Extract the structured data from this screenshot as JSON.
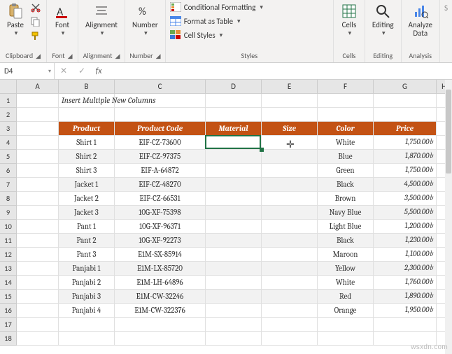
{
  "ribbon": {
    "clipboard": {
      "label": "Clipboard",
      "paste": "Paste"
    },
    "font": {
      "label": "Font",
      "btn": "Font"
    },
    "alignment": {
      "label": "Alignment",
      "btn": "Alignment"
    },
    "number": {
      "label": "Number",
      "btn": "Number"
    },
    "styles": {
      "label": "Styles",
      "cond": "Conditional Formatting",
      "table": "Format as Table",
      "cell": "Cell Styles"
    },
    "cells": {
      "label": "Cells",
      "btn": "Cells"
    },
    "editing": {
      "label": "Editing",
      "btn": "Editing"
    },
    "analysis": {
      "label": "Analysis",
      "btn": "Analyze\nData"
    }
  },
  "namebox": "D4",
  "columns": [
    "A",
    "B",
    "C",
    "D",
    "E",
    "F",
    "G",
    "H"
  ],
  "title": "Insert Multiple New Columns",
  "headers": {
    "product": "Product",
    "code": "Product Code",
    "material": "Material",
    "size": "Size",
    "color": "Color",
    "price": "Price"
  },
  "rows": [
    {
      "product": "Shirt 1",
      "code": "EIF-CZ-73600",
      "color": "White",
      "price": "1,750.00৳"
    },
    {
      "product": "Shirt 2",
      "code": "EIF-CZ-97375",
      "color": "Blue",
      "price": "1,870.00৳"
    },
    {
      "product": "Shirt 3",
      "code": "EIF-A-64872",
      "color": "Green",
      "price": "1,750.00৳"
    },
    {
      "product": "Jacket 1",
      "code": "EIF-CZ-48270",
      "color": "Black",
      "price": "4,500.00৳"
    },
    {
      "product": "Jacket 2",
      "code": "EIF-CZ-66531",
      "color": "Brown",
      "price": "3,500.00৳"
    },
    {
      "product": "Jacket 3",
      "code": "10G-XF-75398",
      "color": "Navy Blue",
      "price": "5,500.00৳"
    },
    {
      "product": "Pant 1",
      "code": "10G-XF-96371",
      "color": "Light Blue",
      "price": "1,200.00৳"
    },
    {
      "product": "Pant 2",
      "code": "10G-XF-92273",
      "color": "Black",
      "price": "1,230.00৳"
    },
    {
      "product": "Pant 3",
      "code": "E1M-SX-85914",
      "color": "Maroon",
      "price": "1,100.00৳"
    },
    {
      "product": "Panjabi 1",
      "code": "E1M-LX-85720",
      "color": "Yellow",
      "price": "2,300.00৳"
    },
    {
      "product": "Panjabi 2",
      "code": "E1M-LH-64896",
      "color": "White",
      "price": "1,760.00৳"
    },
    {
      "product": "Panjabi 3",
      "code": "E1M-CW-32246",
      "color": "Red",
      "price": "1,890.00৳"
    },
    {
      "product": "Panjabi 4",
      "code": "E1M-CW-322376",
      "color": "Orange",
      "price": "1,950.00৳"
    }
  ],
  "watermark": "wsxdn.com"
}
